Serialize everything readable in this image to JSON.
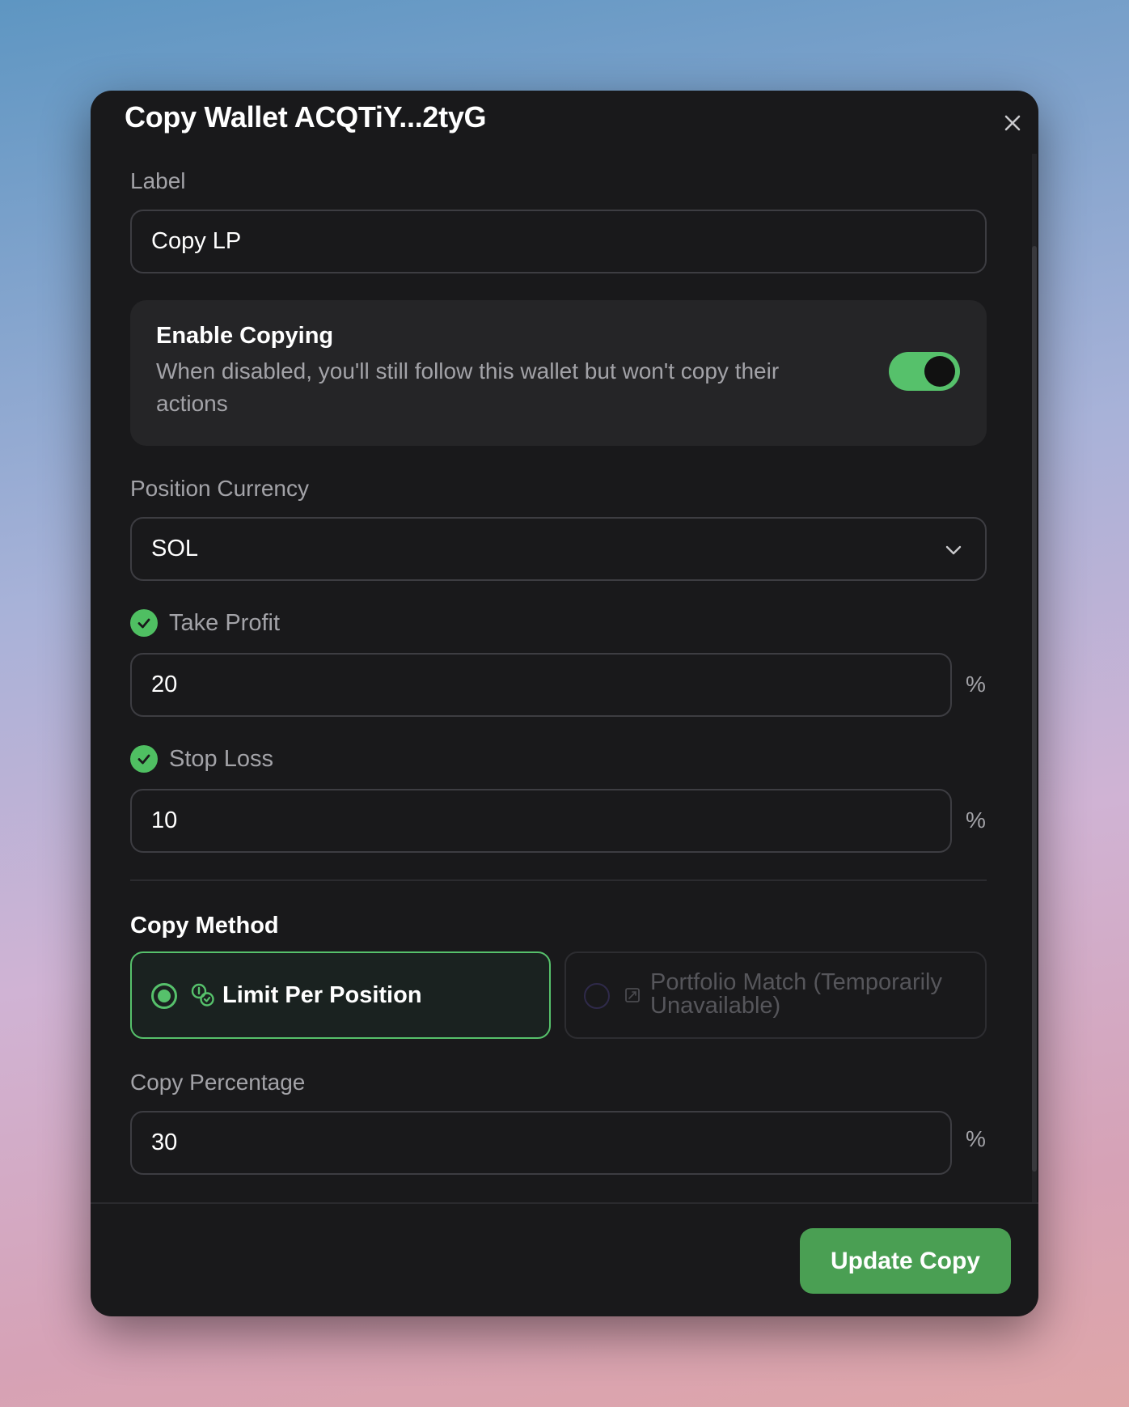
{
  "dialog": {
    "title": "Copy Wallet ACQTiY...2tyG",
    "close_icon": "close-icon"
  },
  "label_field": {
    "label": "Label",
    "value": "Copy LP"
  },
  "enable_copying": {
    "title": "Enable Copying",
    "description": "When disabled, you'll still follow this wallet but won't copy their actions",
    "enabled": true
  },
  "position_currency": {
    "label": "Position Currency",
    "selected": "SOL"
  },
  "take_profit": {
    "label": "Take Profit",
    "checked": true,
    "value": "20",
    "unit": "%"
  },
  "stop_loss": {
    "label": "Stop Loss",
    "checked": true,
    "value": "10",
    "unit": "%"
  },
  "copy_method": {
    "title": "Copy Method",
    "options": [
      {
        "label": "Limit Per Position",
        "selected": true,
        "icon": "coins-icon"
      },
      {
        "label": "Portfolio Match (Temporarily Unavailable)",
        "selected": false,
        "disabled": true,
        "icon": "portfolio-icon"
      }
    ]
  },
  "copy_percentage": {
    "label": "Copy Percentage",
    "value": "30",
    "unit": "%"
  },
  "footer": {
    "submit_label": "Update Copy"
  },
  "colors": {
    "accent": "#56c16b",
    "button": "#4a9f53",
    "panel": "#19191b",
    "card": "#252527"
  }
}
